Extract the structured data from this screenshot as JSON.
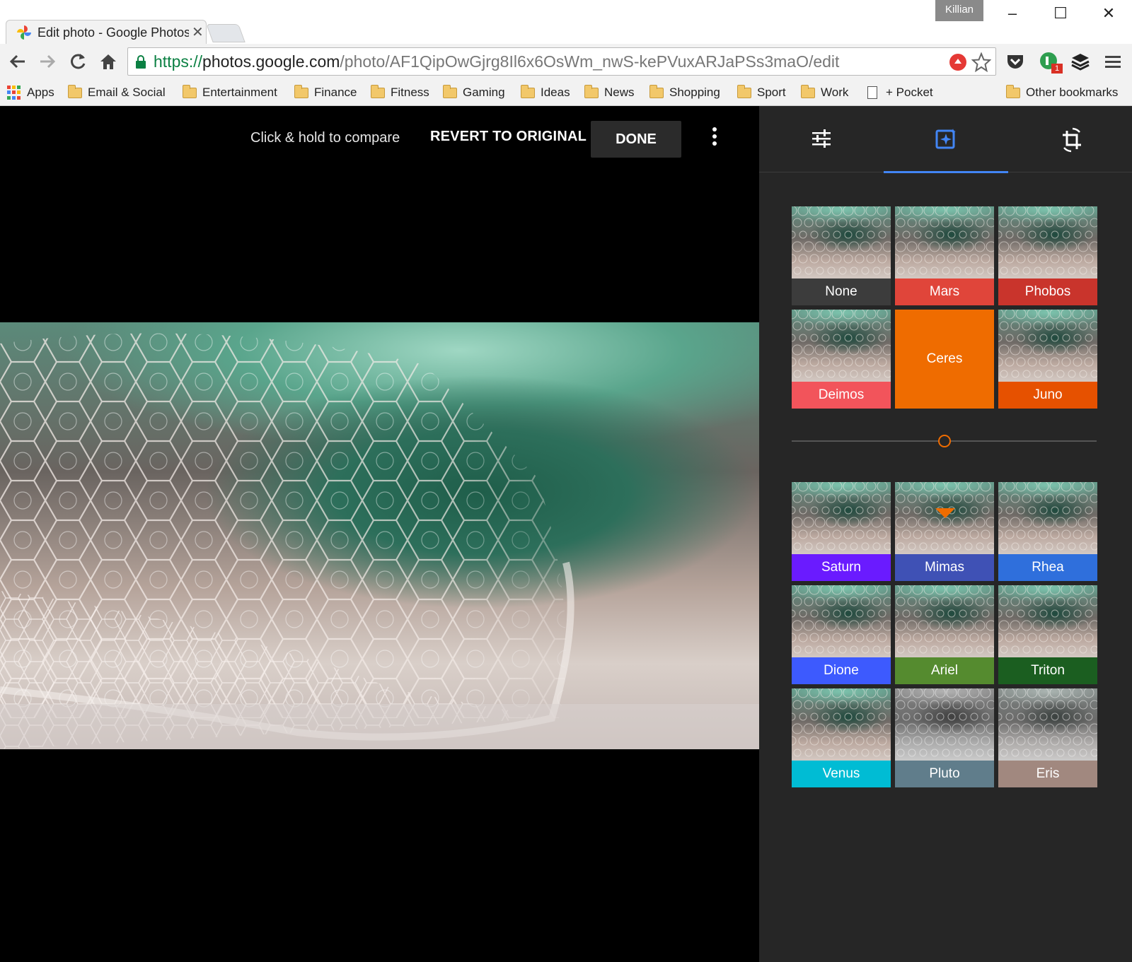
{
  "browser": {
    "tab_title": "Edit photo - Google Photos",
    "profile_name": "Killian",
    "url": {
      "scheme": "https://",
      "host": "photos.google.com",
      "path": "/photo/AF1QipOwGjrg8Il6x6OsWm_nwS-kePVuxARJaPSs3maO/edit"
    },
    "bookmarks": [
      {
        "label": "Apps",
        "icon": "apps-grid-icon"
      },
      {
        "label": "Email & Social",
        "icon": "folder-icon"
      },
      {
        "label": "Entertainment",
        "icon": "folder-icon"
      },
      {
        "label": "Finance",
        "icon": "folder-icon"
      },
      {
        "label": "Fitness",
        "icon": "folder-icon"
      },
      {
        "label": "Gaming",
        "icon": "folder-icon"
      },
      {
        "label": "Ideas",
        "icon": "folder-icon"
      },
      {
        "label": "News",
        "icon": "folder-icon"
      },
      {
        "label": "Shopping",
        "icon": "folder-icon"
      },
      {
        "label": "Sport",
        "icon": "folder-icon"
      },
      {
        "label": "Work",
        "icon": "folder-icon"
      },
      {
        "label": "+ Pocket",
        "icon": "page-icon"
      }
    ],
    "other_bookmarks": "Other bookmarks",
    "extension_badge": "1"
  },
  "editor": {
    "compare_hint": "Click & hold to compare",
    "revert_label": "REVERT TO ORIGINAL",
    "done_label": "DONE"
  },
  "panel": {
    "tabs": [
      {
        "icon": "sliders-icon",
        "active": false
      },
      {
        "icon": "filter-sparkle-icon",
        "active": true
      },
      {
        "icon": "crop-rotate-icon",
        "active": false
      }
    ],
    "accent_color": "#4285f4",
    "filters_top": [
      {
        "name": "None",
        "color": "#3c3c3c"
      },
      {
        "name": "Mars",
        "color": "#e0453a"
      },
      {
        "name": "Phobos",
        "color": "#c9342c"
      },
      {
        "name": "Deimos",
        "color": "#f2545b"
      },
      {
        "name": "Ceres",
        "color": "#ef6c00",
        "selected": true
      },
      {
        "name": "Juno",
        "color": "#e65100"
      }
    ],
    "intensity": 0.5,
    "filters_bottom": [
      {
        "name": "Saturn",
        "color": "#6a1bff"
      },
      {
        "name": "Mimas",
        "color": "#3f51b5"
      },
      {
        "name": "Rhea",
        "color": "#2f6fdc"
      },
      {
        "name": "Dione",
        "color": "#3d5afe"
      },
      {
        "name": "Ariel",
        "color": "#558b2f"
      },
      {
        "name": "Triton",
        "color": "#1b5e20"
      },
      {
        "name": "Venus",
        "color": "#00bcd4"
      },
      {
        "name": "Pluto",
        "color": "#607d8b"
      },
      {
        "name": "Eris",
        "color": "#a1887f"
      }
    ]
  }
}
